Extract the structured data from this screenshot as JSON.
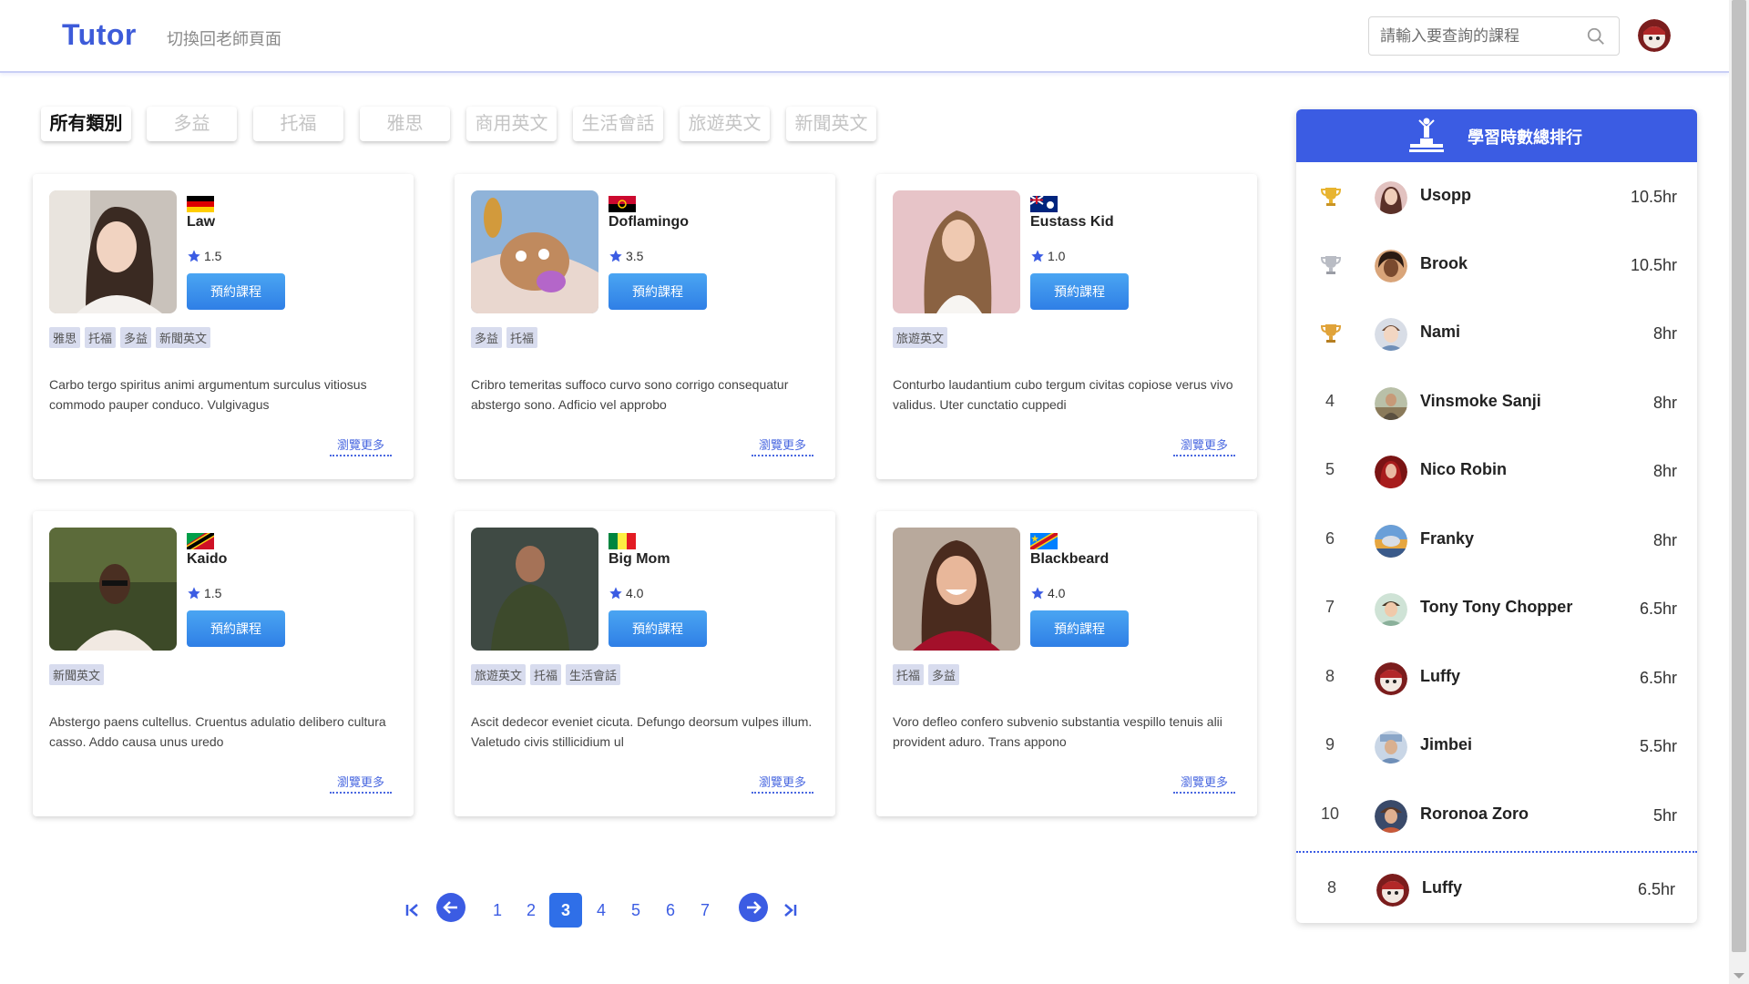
{
  "header": {
    "logo": "Tutor",
    "switch_link": "切換回老師頁面",
    "search_placeholder": "請輸入要查詢的課程",
    "search_icon": "search-icon",
    "avatar_icon": "user-avatar"
  },
  "categories": [
    {
      "label": "所有類別",
      "active": true
    },
    {
      "label": "多益",
      "active": false
    },
    {
      "label": "托福",
      "active": false
    },
    {
      "label": "雅思",
      "active": false
    },
    {
      "label": "商用英文",
      "active": false
    },
    {
      "label": "生活會話",
      "active": false
    },
    {
      "label": "旅遊英文",
      "active": false
    },
    {
      "label": "新聞英文",
      "active": false
    }
  ],
  "teachers": [
    {
      "name": "Law",
      "flag": "germany",
      "rating": "1.5",
      "button": "預約課程",
      "tags": [
        "雅思",
        "托福",
        "多益",
        "新聞英文"
      ],
      "description": "Carbo tergo spiritus animi argumentum surculus vitiosus commodo pauper conduco. Vulgivagus",
      "more": "瀏覽更多"
    },
    {
      "name": "Doflamingo",
      "flag": "angola",
      "rating": "3.5",
      "button": "預約課程",
      "tags": [
        "多益",
        "托福"
      ],
      "description": "Cribro temeritas suffoco curvo sono corrigo consequatur abstergo sono. Adficio vel approbo",
      "more": "瀏覽更多"
    },
    {
      "name": "Eustass Kid",
      "flag": "cayman-islands",
      "rating": "1.0",
      "button": "預約課程",
      "tags": [
        "旅遊英文"
      ],
      "description": "Conturbo laudantium cubo tergum civitas copiose verus vivo validus. Uter cunctatio cuppedi",
      "more": "瀏覽更多"
    },
    {
      "name": "Kaido",
      "flag": "saint-kitts-and-nevis",
      "rating": "1.5",
      "button": "預約課程",
      "tags": [
        "新聞英文"
      ],
      "description": "Abstergo paens cultellus. Cruentus adulatio delibero cultura casso. Addo causa unus uredo",
      "more": "瀏覽更多"
    },
    {
      "name": "Big Mom",
      "flag": "senegal",
      "rating": "4.0",
      "button": "預約課程",
      "tags": [
        "旅遊英文",
        "托福",
        "生活會話"
      ],
      "description": "Ascit dedecor eveniet cicuta. Defungo deorsum vulpes illum. Valetudo civis stillicidium ul",
      "more": "瀏覽更多"
    },
    {
      "name": "Blackbeard",
      "flag": "dr-congo",
      "rating": "4.0",
      "button": "預約課程",
      "tags": [
        "托福",
        "多益"
      ],
      "description": "Voro defleo confero subvenio substantia vespillo tenuis alii provident aduro. Trans appono",
      "more": "瀏覽更多"
    }
  ],
  "pagination": {
    "pages": [
      "1",
      "2",
      "3",
      "4",
      "5",
      "6",
      "7"
    ],
    "current": "3"
  },
  "ranking": {
    "title": "學習時數總排行",
    "rows": [
      {
        "rank": "1",
        "trophy": "gold-trophy",
        "name": "Usopp",
        "hours": "10.5hr"
      },
      {
        "rank": "2",
        "trophy": "silver-trophy",
        "name": "Brook",
        "hours": "10.5hr"
      },
      {
        "rank": "3",
        "trophy": "bronze-trophy",
        "name": "Nami",
        "hours": "8hr"
      },
      {
        "rank": "4",
        "trophy": "",
        "name": "Vinsmoke Sanji",
        "hours": "8hr"
      },
      {
        "rank": "5",
        "trophy": "",
        "name": "Nico Robin",
        "hours": "8hr"
      },
      {
        "rank": "6",
        "trophy": "",
        "name": "Franky",
        "hours": "8hr"
      },
      {
        "rank": "7",
        "trophy": "",
        "name": "Tony Tony Chopper",
        "hours": "6.5hr"
      },
      {
        "rank": "8",
        "trophy": "",
        "name": "Luffy",
        "hours": "6.5hr"
      },
      {
        "rank": "9",
        "trophy": "",
        "name": "Jimbei",
        "hours": "5.5hr"
      },
      {
        "rank": "10",
        "trophy": "",
        "name": "Roronoa Zoro",
        "hours": "5hr"
      }
    ],
    "self": {
      "rank": "8",
      "name": "Luffy",
      "hours": "6.5hr"
    }
  },
  "colors": {
    "brand": "#3b5ce3",
    "button": "#2f7fe6",
    "tag_bg": "#d8dcee"
  }
}
